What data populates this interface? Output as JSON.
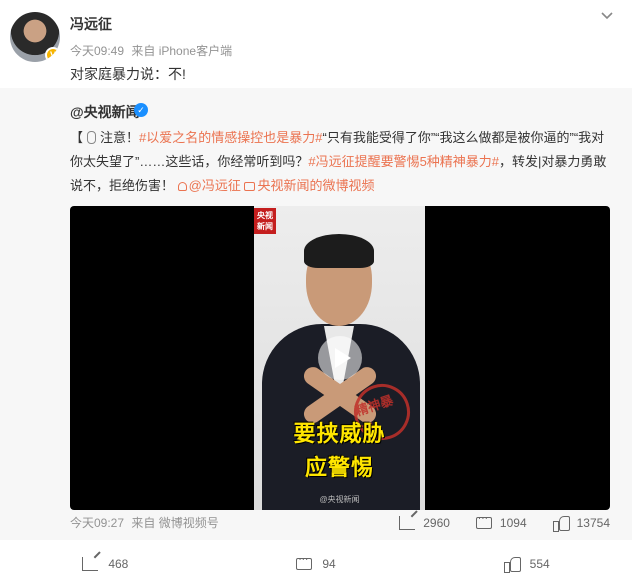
{
  "post": {
    "author": "冯远征",
    "time": "今天09:49",
    "source": "来自 iPhone客户端",
    "text": "对家庭暴力说：不!"
  },
  "repost": {
    "author": "@央视新闻",
    "text_parts": [
      "【",
      "注意！",
      "#以爱之名的情感操控也是暴力#",
      "“只有我能受得了你”“我这么做都是被你逼的”“我对你太失望了”……这些话，你经常听到吗？",
      "#冯远征提醒要警惕5种精神暴力#",
      "，转发|对暴力勇敢说不，拒绝伤害！",
      "@冯远征",
      "央视新闻的微博视频"
    ],
    "video": {
      "logo": "央视\n新闻",
      "stamp_text": "精神暴力",
      "caption_line1": "要挟威胁",
      "caption_line2": "应警惕",
      "watermark": "@央视新闻"
    },
    "time": "今天09:27",
    "source": "来自 微博视频号",
    "shares": "2960",
    "comments": "1094",
    "likes": "13754"
  },
  "actions": {
    "shares": "468",
    "comments": "94",
    "likes": "554"
  },
  "colors": {
    "link": "#eb7350",
    "verified_gold": "#f7b500",
    "verified_blue": "#1a8fff",
    "repost_bg": "#f7f7f7"
  },
  "icons": [
    "dropdown-chevron-icon",
    "mic-icon",
    "person-link-icon",
    "video-link-icon",
    "play-icon",
    "share-icon",
    "comment-icon",
    "like-icon"
  ]
}
